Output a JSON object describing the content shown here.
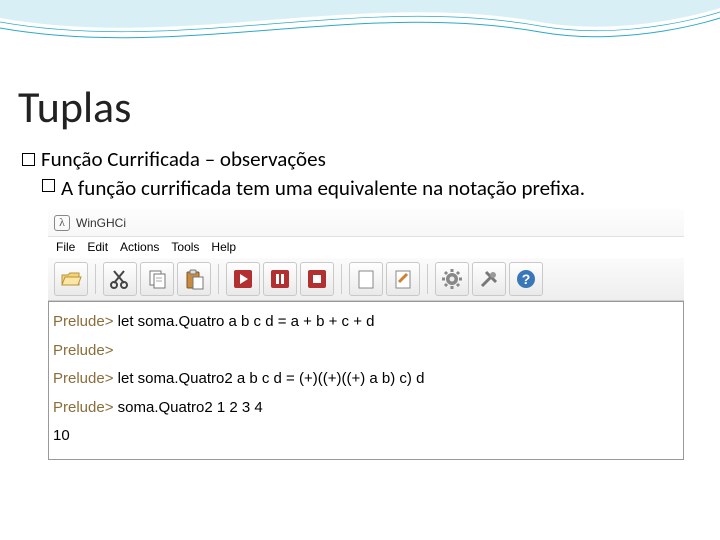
{
  "title": "Tuplas",
  "bullet1": "Função Currificada – observações",
  "bullet2": "A função currificada tem uma equivalente na notação prefixa.",
  "app": {
    "name": "WinGHCi",
    "menus": {
      "m0": "File",
      "m1": "Edit",
      "m2": "Actions",
      "m3": "Tools",
      "m4": "Help"
    },
    "toolbar": {
      "open": "open-icon",
      "cut": "cut-icon",
      "copy": "copy-icon",
      "paste": "paste-icon",
      "run": "run-icon",
      "pause": "pause-icon",
      "stop": "stop-icon",
      "clear": "clear-icon",
      "edit": "edit-icon",
      "settings": "settings-icon",
      "tools": "tools-icon",
      "help": "help-icon"
    },
    "console": {
      "prompt": "Prelude>",
      "line1": "let soma.Quatro a b c d = a + b + c + d",
      "line2_empty": "",
      "line3": "let soma.Quatro2 a b c d = (+)((+)((+) a b) c) d",
      "line4": "soma.Quatro2 1 2 3 4",
      "result": "10"
    }
  }
}
